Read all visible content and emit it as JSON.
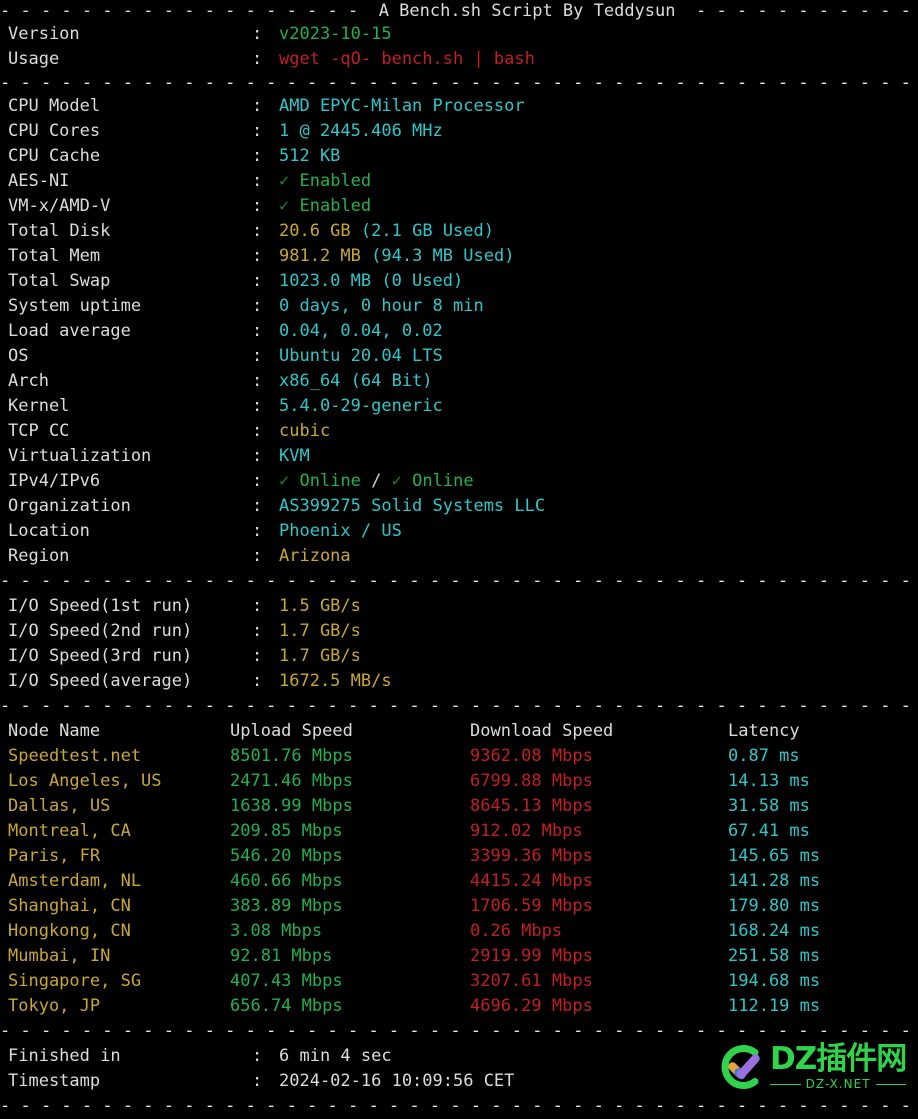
{
  "terminal": {
    "title_line": "- - - - - - - - - - - - - - - - - -  A Bench.sh Script By Teddysun  - - - - - - - - - - - - - - - - - -",
    "divider": "- - - - - - - - - - - - - - - - - - - - - - - - - - - - - - - - - - - - - - - - - - - - - - - - - - - - - - - - - -",
    "colon": ":"
  },
  "meta": {
    "version": {
      "label": "Version",
      "value": "v2023-10-15"
    },
    "usage": {
      "label": "Usage",
      "value": "wget -qO- bench.sh | bash"
    }
  },
  "sysinfo": [
    {
      "label": "CPU Model",
      "value": "AMD EPYC-Milan Processor"
    },
    {
      "label": "CPU Cores",
      "value": "1 @ 2445.406 MHz"
    },
    {
      "label": "CPU Cache",
      "value": "512 KB"
    },
    {
      "label": "AES-NI",
      "check": "✓",
      "value": "Enabled"
    },
    {
      "label": "VM-x/AMD-V",
      "check": "✓",
      "value": "Enabled"
    },
    {
      "label": "Total Disk",
      "value": "20.6 GB",
      "extra": "(2.1 GB Used)"
    },
    {
      "label": "Total Mem",
      "value": "981.2 MB",
      "extra": "(94.3 MB Used)"
    },
    {
      "label": "Total Swap",
      "value": "1023.0 MB (0 Used)"
    },
    {
      "label": "System uptime",
      "value": "0 days, 0 hour 8 min"
    },
    {
      "label": "Load average",
      "value": "0.04, 0.04, 0.02"
    },
    {
      "label": "OS",
      "value": "Ubuntu 20.04 LTS"
    },
    {
      "label": "Arch",
      "value": "x86_64 (64 Bit)"
    },
    {
      "label": "Kernel",
      "value": "5.4.0-29-generic"
    },
    {
      "label": "TCP CC",
      "value": "cubic"
    },
    {
      "label": "Virtualization",
      "value": "KVM"
    },
    {
      "label": "IPv4/IPv6",
      "check": "✓",
      "value": "Online",
      "separator": "/",
      "check2": "✓",
      "value2": "Online"
    },
    {
      "label": "Organization",
      "value": "AS399275 Solid Systems LLC"
    },
    {
      "label": "Location",
      "value": "Phoenix / US"
    },
    {
      "label": "Region",
      "value": "Arizona"
    }
  ],
  "io_speed": [
    {
      "label": "I/O Speed(1st run)",
      "value": "1.5 GB/s"
    },
    {
      "label": "I/O Speed(2nd run)",
      "value": "1.7 GB/s"
    },
    {
      "label": "I/O Speed(3rd run)",
      "value": "1.7 GB/s"
    },
    {
      "label": "I/O Speed(average)",
      "value": "1672.5 MB/s"
    }
  ],
  "speedtest": {
    "headers": [
      "Node Name",
      "Upload Speed",
      "Download Speed",
      "Latency"
    ],
    "rows": [
      {
        "node": "Speedtest.net",
        "upload": "8501.76 Mbps",
        "download": "9362.08 Mbps",
        "latency": "0.87 ms"
      },
      {
        "node": "Los Angeles, US",
        "upload": "2471.46 Mbps",
        "download": "6799.88 Mbps",
        "latency": "14.13 ms"
      },
      {
        "node": "Dallas, US",
        "upload": "1638.99 Mbps",
        "download": "8645.13 Mbps",
        "latency": "31.58 ms"
      },
      {
        "node": "Montreal, CA",
        "upload": "209.85 Mbps",
        "download": "912.02 Mbps",
        "latency": "67.41 ms"
      },
      {
        "node": "Paris, FR",
        "upload": "546.20 Mbps",
        "download": "3399.36 Mbps",
        "latency": "145.65 ms"
      },
      {
        "node": "Amsterdam, NL",
        "upload": "460.66 Mbps",
        "download": "4415.24 Mbps",
        "latency": "141.28 ms"
      },
      {
        "node": "Shanghai, CN",
        "upload": "383.89 Mbps",
        "download": "1706.59 Mbps",
        "latency": "179.80 ms"
      },
      {
        "node": "Hongkong, CN",
        "upload": "3.08 Mbps",
        "download": "0.26 Mbps",
        "latency": "168.24 ms"
      },
      {
        "node": "Mumbai, IN",
        "upload": "92.81 Mbps",
        "download": "2919.99 Mbps",
        "latency": "251.58 ms"
      },
      {
        "node": "Singapore, SG",
        "upload": "407.43 Mbps",
        "download": "3207.61 Mbps",
        "latency": "194.68 ms"
      },
      {
        "node": "Tokyo, JP",
        "upload": "656.74 Mbps",
        "download": "4696.29 Mbps",
        "latency": "112.19 ms"
      }
    ]
  },
  "footer": [
    {
      "label": "Finished in",
      "value": "6 min 4 sec"
    },
    {
      "label": "Timestamp",
      "value": "2024-02-16 10:09:56 CET"
    }
  ],
  "watermark": {
    "title": "DZ插件网",
    "subtitle": "DZ-X.NET",
    "ring_color": "#2fd44a",
    "check_short_color": "#e8a33d",
    "check_joint_color": "#3b7fd4",
    "check_long_color": "#9b6fe0"
  }
}
